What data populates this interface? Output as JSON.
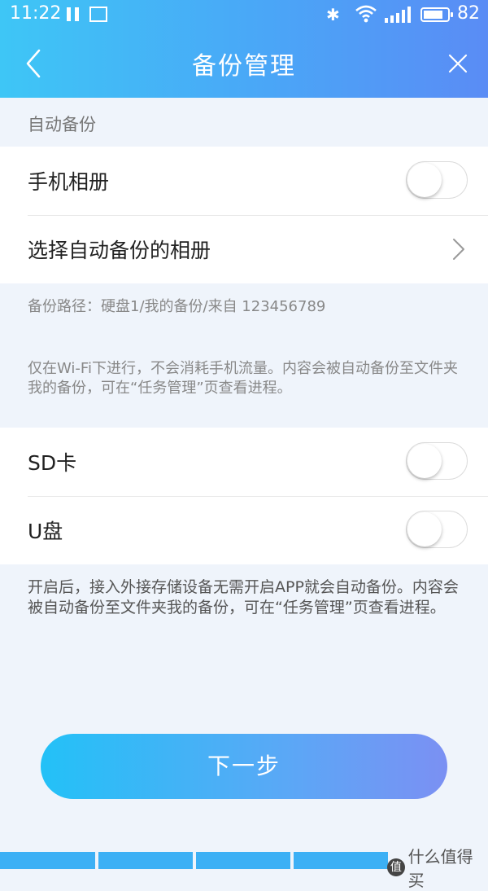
{
  "status_bar": {
    "time": "11:22",
    "battery_percent": "82",
    "battery_level": 0.82
  },
  "header": {
    "title": "备份管理"
  },
  "auto_backup": {
    "section_label": "自动备份",
    "items": [
      {
        "label": "手机相册",
        "toggle_on": false
      },
      {
        "label": "选择自动备份的相册"
      }
    ],
    "path_text": "备份路径：硬盘1/我的备份/来自 123456789",
    "wifi_note": "仅在Wi-Fi下进行，不会消耗手机流量。内容会被自动备份至文件夹我的备份，可在“任务管理”页查看进程。"
  },
  "external_backup": {
    "items": [
      {
        "label": "SD卡",
        "toggle_on": false
      },
      {
        "label": "U盘",
        "toggle_on": false
      }
    ],
    "note": "开启后，接入外接存储设备无需开启APP就会自动备份。内容会被自动备份至文件夹我的备份，可在“任务管理”页查看进程。"
  },
  "next_button": {
    "label": "下一步"
  },
  "watermark": {
    "logo_char": "值",
    "text": "什么值得买"
  },
  "colors": {
    "header_start": "#3ec6f6",
    "header_end": "#5a8cf5",
    "page_bg": "#eff4fb",
    "button_start": "#23c1f7",
    "button_end": "#7b90f3"
  }
}
